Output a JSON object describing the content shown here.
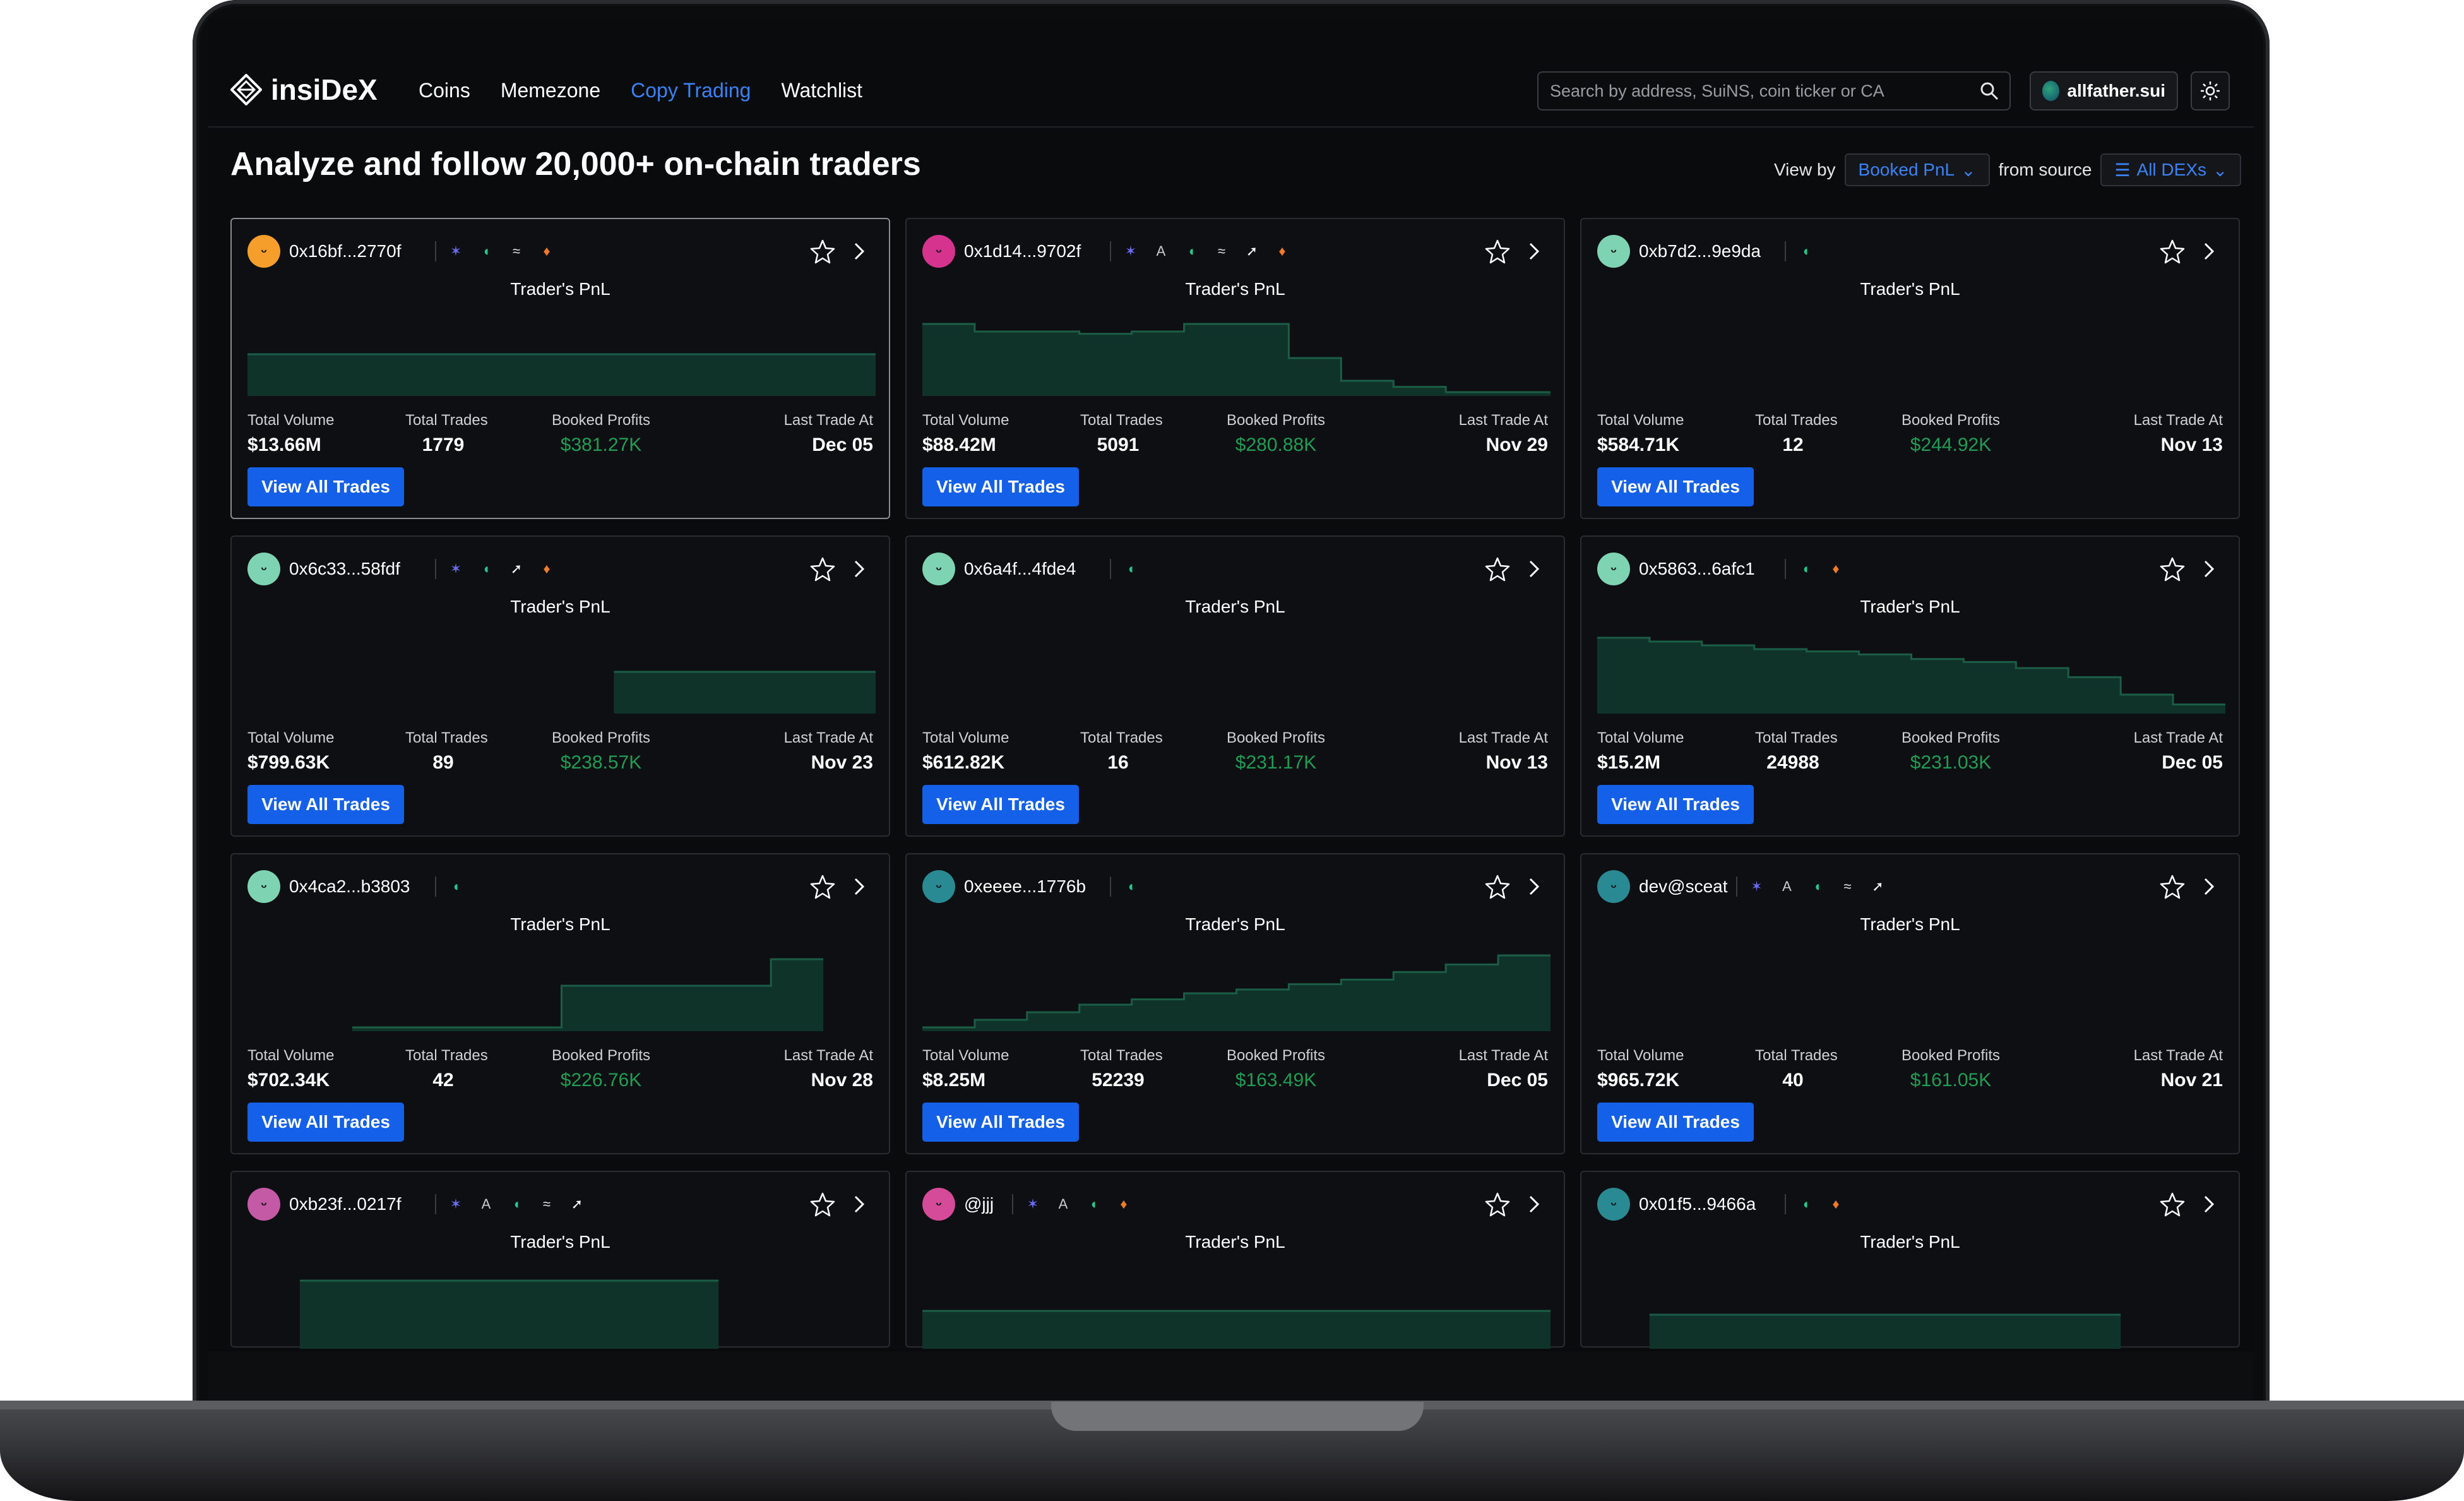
{
  "app": {
    "logo_text": "insiDeX",
    "nav": [
      "Coins",
      "Memezone",
      "Copy Trading",
      "Watchlist"
    ],
    "active_nav": "Copy Trading",
    "search_placeholder": "Search by address, SuiNS, coin ticker or CA",
    "user_name": "allfather.sui"
  },
  "page": {
    "headline": "Analyze and follow 20,000+ on-chain traders",
    "view_by_label": "View by",
    "view_by_value": "Booked PnL",
    "source_label": "from source",
    "source_value": "All DEXs"
  },
  "labels": {
    "pnl_title": "Trader's PnL",
    "total_volume": "Total Volume",
    "total_trades": "Total Trades",
    "booked_profits": "Booked Profits",
    "last_trade_at": "Last Trade At",
    "view_all": "View All Trades"
  },
  "colors": {
    "accent_blue": "#1560e8",
    "link_blue": "#3b82f6",
    "profit_green": "#1f9d55",
    "chart_fill": "#0f3328",
    "chart_line": "#1b5e45"
  },
  "cards": [
    {
      "address": "0x16bf...2770f",
      "avatar": "#f59e2b",
      "dexes": [
        "star",
        "wave",
        "swirl",
        "flame"
      ],
      "volume": "$13.66M",
      "trades": "1779",
      "profits": "$381.27K",
      "last": "Dec 05",
      "pnl": [
        0.55,
        0.55,
        0.55,
        0.55,
        0.55,
        0.55,
        0.55,
        0.55,
        0.55,
        0.55,
        0.55,
        0.55
      ]
    },
    {
      "address": "0x1d14...9702f",
      "avatar": "#d6338f",
      "dexes": [
        "star",
        "a",
        "wave",
        "swirl",
        "arrow",
        "flame"
      ],
      "volume": "$88.42M",
      "trades": "5091",
      "profits": "$280.88K",
      "last": "Nov 29",
      "pnl": [
        0.95,
        0.85,
        0.85,
        0.82,
        0.85,
        0.95,
        0.95,
        0.5,
        0.2,
        0.12,
        0.05,
        0.05
      ]
    },
    {
      "address": "0xb7d2...9e9da",
      "avatar": "#7ed3b2",
      "dexes": [
        "wave"
      ],
      "volume": "$584.71K",
      "trades": "12",
      "profits": "$244.92K",
      "last": "Nov 13",
      "pnl": [
        0,
        0,
        0,
        0,
        0,
        0,
        0,
        0,
        0,
        0,
        0,
        0
      ]
    },
    {
      "address": "0x6c33...58fdf",
      "avatar": "#7ed3b2",
      "dexes": [
        "star",
        "wave",
        "arrow",
        "flame"
      ],
      "volume": "$799.63K",
      "trades": "89",
      "profits": "$238.57K",
      "last": "Nov 23",
      "pnl": [
        0,
        0,
        0,
        0,
        0,
        0,
        0,
        0.55,
        0.55,
        0.55,
        0.55,
        0.55
      ]
    },
    {
      "address": "0x6a4f...4fde4",
      "avatar": "#7ed3b2",
      "dexes": [
        "wave"
      ],
      "volume": "$612.82K",
      "trades": "16",
      "profits": "$231.17K",
      "last": "Nov 13",
      "pnl": [
        0,
        0,
        0,
        0,
        0,
        0,
        0,
        0,
        0,
        0,
        0,
        0
      ]
    },
    {
      "address": "0x5863...6afc1",
      "avatar": "#7ed3b2",
      "dexes": [
        "wave",
        "flame"
      ],
      "volume": "$15.2M",
      "trades": "24988",
      "profits": "$231.03K",
      "last": "Dec 05",
      "pnl": [
        1.0,
        0.95,
        0.9,
        0.85,
        0.82,
        0.78,
        0.72,
        0.68,
        0.6,
        0.48,
        0.25,
        0.12
      ]
    },
    {
      "address": "0x4ca2...b3803",
      "avatar": "#7ed3b2",
      "dexes": [
        "wave"
      ],
      "volume": "$702.34K",
      "trades": "42",
      "profits": "$226.76K",
      "last": "Nov 28",
      "pnl": [
        0,
        0,
        0.05,
        0.05,
        0.05,
        0.05,
        0.6,
        0.6,
        0.6,
        0.6,
        0.95,
        0
      ]
    },
    {
      "address": "0xeeee...1776b",
      "avatar": "#2a8a93",
      "dexes": [
        "wave"
      ],
      "volume": "$8.25M",
      "trades": "52239",
      "profits": "$163.49K",
      "last": "Dec 05",
      "pnl": [
        0.05,
        0.15,
        0.25,
        0.35,
        0.42,
        0.5,
        0.55,
        0.62,
        0.68,
        0.78,
        0.88,
        1.0
      ]
    },
    {
      "address": "dev@sceat",
      "avatar": "#2a8a93",
      "dexes": [
        "star",
        "a",
        "wave",
        "swirl",
        "arrow"
      ],
      "volume": "$965.72K",
      "trades": "40",
      "profits": "$161.05K",
      "last": "Nov 21",
      "pnl": [
        0,
        0,
        0,
        0,
        0,
        0,
        0,
        0,
        0,
        0,
        0,
        0
      ]
    },
    {
      "address": "0xb23f...0217f",
      "avatar": "#c45aa6",
      "dexes": [
        "star",
        "a",
        "wave",
        "swirl",
        "arrow"
      ],
      "pnl": [
        0,
        0.9,
        0.9,
        0.9,
        0.9,
        0.9,
        0.9,
        0.9,
        0.9,
        0,
        0,
        0
      ]
    },
    {
      "address": "@jjj",
      "avatar": "#d64a9a",
      "dexes": [
        "star",
        "a",
        "wave",
        "flame"
      ],
      "pnl": [
        0.5,
        0.5,
        0.5,
        0.5,
        0.5,
        0.5,
        0.5,
        0.5,
        0.5,
        0.5,
        0.5,
        0.5
      ]
    },
    {
      "address": "0x01f5...9466a",
      "avatar": "#2a8a93",
      "dexes": [
        "wave",
        "flame"
      ],
      "pnl": [
        0,
        0.45,
        0.45,
        0.45,
        0.45,
        0.45,
        0.45,
        0.45,
        0.45,
        0.45,
        0,
        0
      ]
    }
  ]
}
